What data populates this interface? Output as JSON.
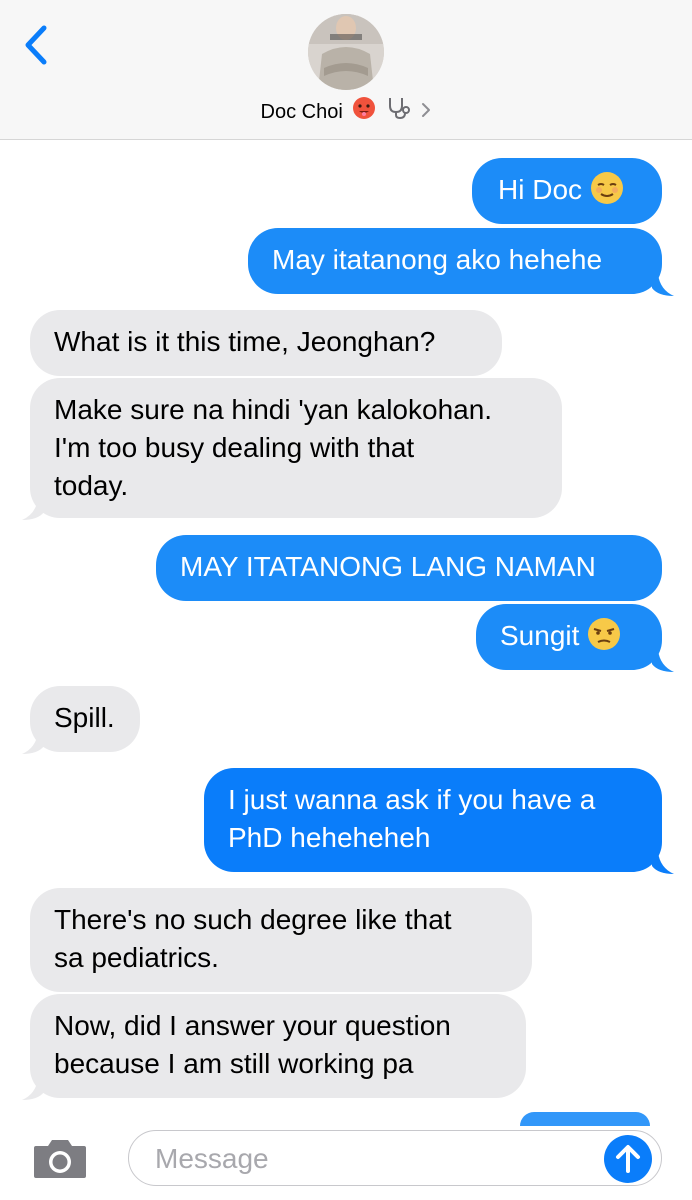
{
  "header": {
    "contact_name": "Doc Choi",
    "contact_emojis": [
      "hot-face-emoji",
      "stethoscope-emoji"
    ],
    "back_icon": "chevron-left-icon",
    "details_icon": "chevron-right-icon"
  },
  "colors": {
    "sent_bubble": "#1c8cf8",
    "received_bubble": "#e9e9eb",
    "accent": "#0a7dfa",
    "header_bg": "#f7f7f7"
  },
  "messages": [
    {
      "from": "me",
      "lines": [
        "Hi Doc"
      ],
      "emoji": "relieved-face-emoji"
    },
    {
      "from": "me",
      "lines": [
        "May itatanong ako hehehe"
      ]
    },
    {
      "from": "them",
      "lines": [
        "What is it this time, Jeonghan?"
      ]
    },
    {
      "from": "them",
      "lines": [
        "Make sure na hindi 'yan kalokohan.",
        "I'm too busy dealing with that",
        "today."
      ]
    },
    {
      "from": "me",
      "lines": [
        "MAY ITATANONG LANG NAMAN"
      ]
    },
    {
      "from": "me",
      "lines": [
        "Sungit"
      ],
      "emoji": "unamused-face-emoji"
    },
    {
      "from": "them",
      "lines": [
        "Spill."
      ]
    },
    {
      "from": "me",
      "lines": [
        "I just wanna ask if you have a",
        "PhD heheheheh"
      ]
    },
    {
      "from": "them",
      "lines": [
        "There's no such degree like that",
        "sa pediatrics."
      ]
    },
    {
      "from": "them",
      "lines": [
        "Now, did I answer your question",
        "because I am still working pa"
      ]
    }
  ],
  "input": {
    "placeholder": "Message",
    "value": ""
  }
}
